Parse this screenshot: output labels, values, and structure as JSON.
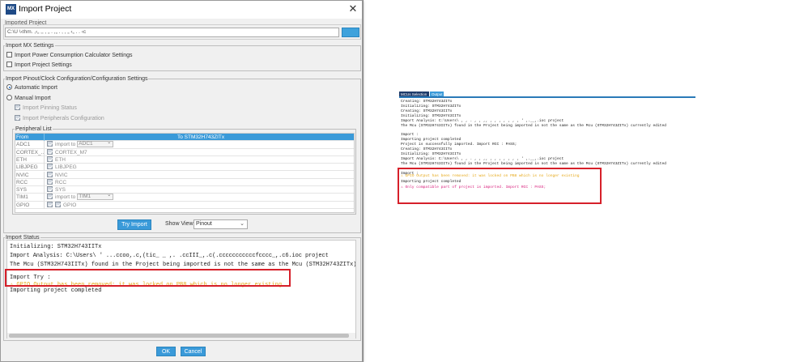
{
  "dialog": {
    "title": "Import Project",
    "logo": "MX",
    "imported_project_label": "Imported Project",
    "imported_project_path": "C:\\U    \\‹thm.      ,‹„  ,,  ,  „    .     ,„ .  ,   ,  „  ‹„ .  .   ‹c",
    "mx_settings_label": "Import MX Settings",
    "power_calc_label": "Import Power Consumption Calculator Settings",
    "project_settings_label": "Import Project Settings",
    "pinout_section_label": "Import Pinout/Clock Configuration/Configuration Settings",
    "automatic_import_label": "Automatic Import",
    "manual_import_label": "Manual Import",
    "pinning_status_label": "Import Pinning Status",
    "peripherals_config_label": "Import Peripherals Configuration",
    "peripheral_list_label": "Peripheral List",
    "table_header_from": "From STM...",
    "table_header_to": "To STM32H743ZITx",
    "peripherals": [
      {
        "name": "ADC1",
        "import_to": "import to",
        "target": "ADC1",
        "dropdown": true
      },
      {
        "name": "CORTEX_...",
        "target": "CORTEX_M7",
        "dropdown": false
      },
      {
        "name": "ETH",
        "target": "ETH",
        "dropdown": false
      },
      {
        "name": "LIBJPEG",
        "target": "LIBJPEG",
        "dropdown": false
      },
      {
        "name": "NVIC",
        "target": "NVIC",
        "dropdown": false
      },
      {
        "name": "RCC",
        "target": "RCC",
        "dropdown": false
      },
      {
        "name": "SYS",
        "target": "SYS",
        "dropdown": false
      },
      {
        "name": "TIM1",
        "import_to": "import to",
        "target": "TIM1",
        "dropdown": true
      },
      {
        "name": "GPIO",
        "target": "GPIO",
        "dropdown": false
      }
    ],
    "try_import_label": "Try Import",
    "show_view_label": "Show View",
    "show_view_value": "Pinout",
    "import_status_label": "Import Status",
    "status_lines": [
      "Initializing: STM32H743IITx",
      "Import Analysis: C:\\Users\\    '      ...ccoo,.c,(tic_ _       ,.        .ccIII_,.c(.cccccccccccfcccc_,.c6.ioc project",
      "The Mcu (STM32H743IITx) found in the Project being imported is not the same as the Mcu (STM32H743ZITx) curren"
    ],
    "status_try_line": "Import Try :",
    "status_warning": "⚠ GPIO Output has been removed: it was locked on PB8 which is no longer existing",
    "status_completed": "Importing project completed",
    "ok_label": "OK",
    "cancel_label": "Cancel"
  },
  "output_panel": {
    "tabs": [
      "MCUs Selection",
      "Output"
    ],
    "lines": [
      "Creating: STM32H743ZITx",
      "Initializing: STM32H743ZITx",
      "Creating: STM32H743IITx",
      "Initializing: STM32H743IITx",
      "Import Analysis: C:\\Users\\    ,    ,   .      ,    ,     ,,  ,   ,    ,    ,    ,    ,     ,    '      ,.__,.ioc project",
      "The Mcu (STM32H743IITx) found in the Project being imported is not the same as the Mcu (STM32H743ZITx) currently edited",
      "",
      "Import :",
      "Importing project completed",
      "Project is successfully imported. Import RCC : PASS;",
      "Creating: STM32H743IITx",
      "Initializing: STM32H743IITx",
      "Import Analysis: C:\\Users\\    ,    ,   .      ,    ,     ,,  ,   ,    ,    ,    ,    ,     ,    '      ,.__,.ioc project",
      "The Mcu (STM32H743IITx) found in the Project being imported is not the same as the Mcu (STM32H743ZITx) currently edited",
      "",
      "Import :"
    ],
    "warning_line": "⚠ GPIO Output has been removed: it was locked on PB8 which is no longer existing",
    "completed_line": "Importing project completed",
    "partial_line": "⚠ Only compatible part of project is imported.    Import RCC : PASS;"
  },
  "colors": {
    "accent": "#3a9ad9",
    "highlight_box": "#d6202a",
    "warning_text": "#e6a817",
    "error_text": "#d81b7a"
  }
}
